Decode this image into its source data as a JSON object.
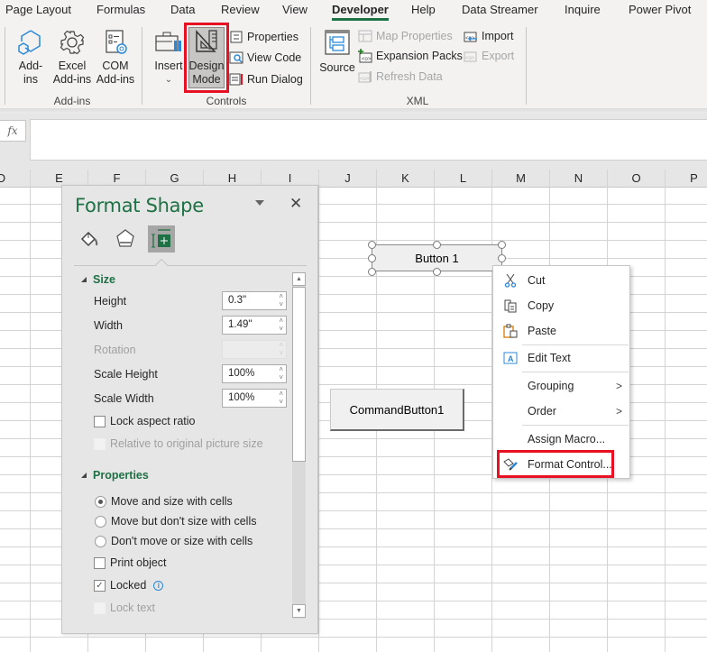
{
  "ribbon_tabs": [
    {
      "label": "Page Layout",
      "active": false
    },
    {
      "label": "Formulas",
      "active": false
    },
    {
      "label": "Data",
      "active": false
    },
    {
      "label": "Review",
      "active": false
    },
    {
      "label": "View",
      "active": false
    },
    {
      "label": "Developer",
      "active": true
    },
    {
      "label": "Help",
      "active": false
    },
    {
      "label": "Data Streamer",
      "active": false
    },
    {
      "label": "Inquire",
      "active": false
    },
    {
      "label": "Power Pivot",
      "active": false
    }
  ],
  "ribbon": {
    "addins_group": {
      "label": "Add-ins",
      "addins": {
        "line1": "Add-",
        "line2": "ins"
      },
      "excel_addins": {
        "line1": "Excel",
        "line2": "Add-ins"
      },
      "com_addins": {
        "line1": "COM",
        "line2": "Add-ins"
      }
    },
    "controls_group": {
      "label": "Controls",
      "insert": {
        "label": "Insert",
        "chevron": "⌄"
      },
      "design_mode": {
        "line1": "Design",
        "line2": "Mode",
        "pressed": true
      },
      "properties": "Properties",
      "view_code": "View Code",
      "run_dialog": "Run Dialog"
    },
    "xml_group": {
      "label": "XML",
      "source": "Source",
      "map_properties": "Map Properties",
      "expansion_packs": "Expansion Packs",
      "refresh_data": "Refresh Data",
      "import": "Import",
      "export": "Export"
    }
  },
  "formula_bar": {
    "fx_label": "fx",
    "value": ""
  },
  "columns": [
    "D",
    "E",
    "F",
    "G",
    "H",
    "I",
    "J",
    "K",
    "L",
    "M",
    "N",
    "O",
    "P"
  ],
  "format_pane": {
    "title": "Format Shape",
    "tabs": [
      "fill-line",
      "effects",
      "size-properties"
    ],
    "size_section": {
      "header": "Size",
      "height": {
        "label": "Height",
        "value": "0.3\""
      },
      "width": {
        "label": "Width",
        "value": "1.49\""
      },
      "rotation": {
        "label": "Rotation",
        "value": ""
      },
      "scale_height": {
        "label": "Scale Height",
        "value": "100%"
      },
      "scale_width": {
        "label": "Scale Width",
        "value": "100%"
      },
      "lock_aspect": {
        "label": "Lock aspect ratio",
        "checked": false
      },
      "relative_original": {
        "label": "Relative to original picture size",
        "checked": false,
        "disabled": true
      }
    },
    "properties_section": {
      "header": "Properties",
      "radio_options": [
        {
          "label": "Move and size with cells",
          "selected": true
        },
        {
          "label": "Move but don't size with cells",
          "selected": false
        },
        {
          "label": "Don't move or size with cells",
          "selected": false
        }
      ],
      "print_object": {
        "label": "Print object",
        "checked": false
      },
      "locked": {
        "label": "Locked",
        "checked": true
      },
      "lock_text": {
        "label": "Lock text",
        "checked": false,
        "disabled": true
      }
    }
  },
  "sheet_objects": {
    "form_button": "Button 1",
    "command_button": "CommandButton1"
  },
  "context_menu": {
    "items": [
      {
        "label": "Cut",
        "icon": "scissors-icon"
      },
      {
        "label": "Copy",
        "icon": "copy-icon"
      },
      {
        "label": "Paste",
        "icon": "paste-icon"
      },
      {
        "label": "Edit Text",
        "icon": "edit-text-icon"
      },
      {
        "label": "Grouping",
        "submenu": ">"
      },
      {
        "label": "Order",
        "submenu": ">"
      },
      {
        "label": "Assign Macro..."
      },
      {
        "label": "Format Control...",
        "icon": "format-control-icon",
        "highlighted": true
      }
    ]
  },
  "colors": {
    "accent_green": "#1e7145",
    "highlight_red": "#e81123"
  }
}
